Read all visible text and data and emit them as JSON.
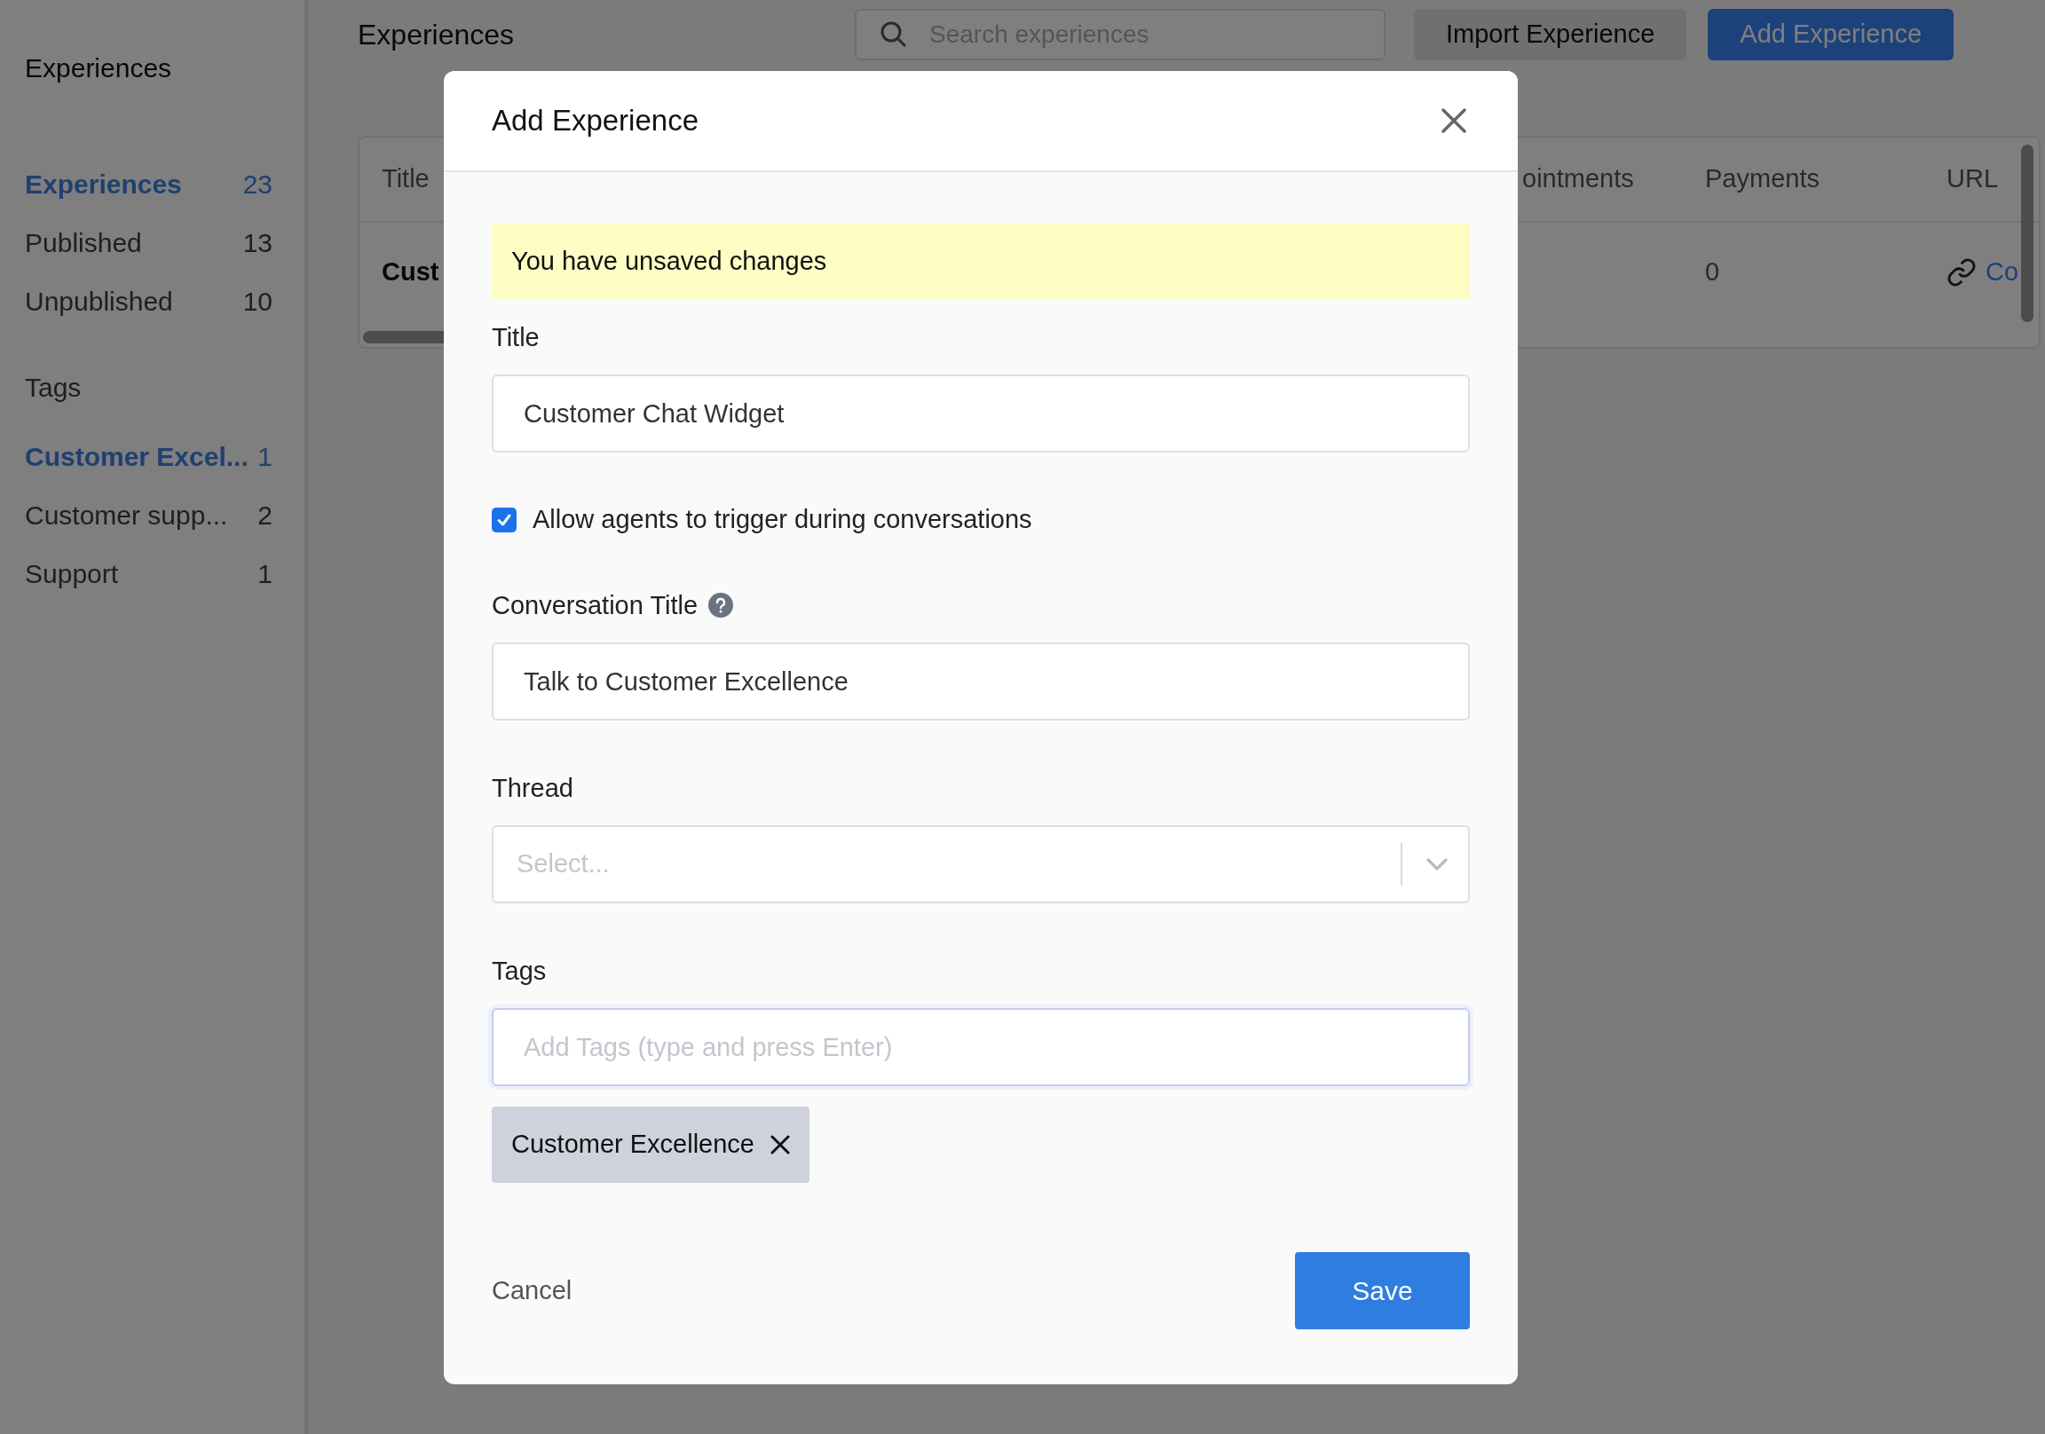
{
  "sidebar": {
    "title": "Experiences",
    "filters": [
      {
        "label": "Experiences",
        "count": "23",
        "selected": true
      },
      {
        "label": "Published",
        "count": "13",
        "selected": false
      },
      {
        "label": "Unpublished",
        "count": "10",
        "selected": false
      }
    ],
    "tags_heading": "Tags",
    "tags": [
      {
        "label": "Customer Excel...",
        "count": "1",
        "selected": true
      },
      {
        "label": "Customer supp...",
        "count": "2",
        "selected": false
      },
      {
        "label": "Support",
        "count": "1",
        "selected": false
      }
    ]
  },
  "page": {
    "title": "Experiences",
    "search": {
      "placeholder": "Search experiences"
    },
    "buttons": [
      {
        "label": "Import Experience",
        "kind": "secondary"
      },
      {
        "label": "Add Experience",
        "kind": "primary"
      }
    ]
  },
  "table": {
    "columns": [
      "Title",
      "ointments",
      "Payments",
      "URL"
    ],
    "rows": [
      {
        "title": "Cust",
        "payments": "0",
        "url": "Co"
      }
    ]
  },
  "modal": {
    "title": "Add Experience",
    "alert": "You have unsaved changes",
    "fields": [
      {
        "kind": "text",
        "label": "Title",
        "value": "Customer Chat Widget"
      },
      {
        "kind": "checkbox",
        "label": "Allow agents to trigger during conversations",
        "checked": true
      },
      {
        "kind": "text",
        "label": "Conversation Title",
        "help": true,
        "value": "Talk to Customer Excellence"
      },
      {
        "kind": "select",
        "label": "Thread",
        "placeholder": "Select..."
      },
      {
        "kind": "tags",
        "label": "Tags",
        "placeholder": "Add Tags (type and press Enter)",
        "focused": true,
        "tags": [
          "Customer Excellence"
        ]
      }
    ],
    "cancel": "Cancel",
    "save": "Save"
  }
}
